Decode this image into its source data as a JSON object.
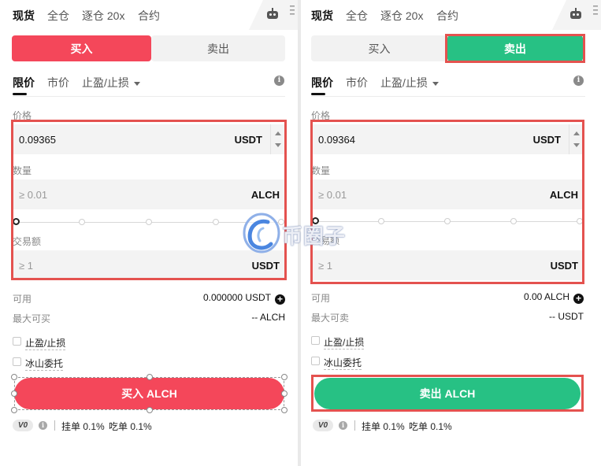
{
  "panels": {
    "buy": {
      "tabs": [
        "现货",
        "全仓",
        "逐仓 20x",
        "合约"
      ],
      "seg_buy": "买入",
      "seg_sell": "卖出",
      "order_tabs": [
        "限价",
        "市价",
        "止盈/止损"
      ],
      "price_label": "价格",
      "price_value": "0.09365",
      "price_unit": "USDT",
      "qty_label": "数量",
      "qty_placeholder": "≥ 0.01",
      "qty_unit": "ALCH",
      "amount_label": "交易额",
      "amount_placeholder": "≥ 1",
      "amount_unit": "USDT",
      "available_label": "可用",
      "available_value": "0.000000 USDT",
      "max_label": "最大可买",
      "max_value": "-- ALCH",
      "tpsl_label": "止盈/止损",
      "iceberg_label": "冰山委托",
      "submit_label": "买入 ALCH",
      "vip": "V0",
      "maker_fee": "挂单 0.1%",
      "taker_fee": "吃单 0.1%"
    },
    "sell": {
      "tabs": [
        "现货",
        "全仓",
        "逐仓 20x",
        "合约"
      ],
      "seg_buy": "买入",
      "seg_sell": "卖出",
      "order_tabs": [
        "限价",
        "市价",
        "止盈/止损"
      ],
      "price_label": "价格",
      "price_value": "0.09364",
      "price_unit": "USDT",
      "qty_label": "数量",
      "qty_placeholder": "≥ 0.01",
      "qty_unit": "ALCH",
      "amount_label": "交易额",
      "amount_placeholder": "≥ 1",
      "amount_unit": "USDT",
      "available_label": "可用",
      "available_value": "0.00 ALCH",
      "max_label": "最大可卖",
      "max_value": "-- USDT",
      "tpsl_label": "止盈/止损",
      "iceberg_label": "冰山委托",
      "submit_label": "卖出 ALCH",
      "vip": "V0",
      "maker_fee": "挂单 0.1%",
      "taker_fee": "吃单 0.1%"
    }
  },
  "watermark": {
    "text": "币圈子"
  },
  "colors": {
    "buy": "#f4475a",
    "sell": "#27c184",
    "highlight": "#e4524f"
  }
}
